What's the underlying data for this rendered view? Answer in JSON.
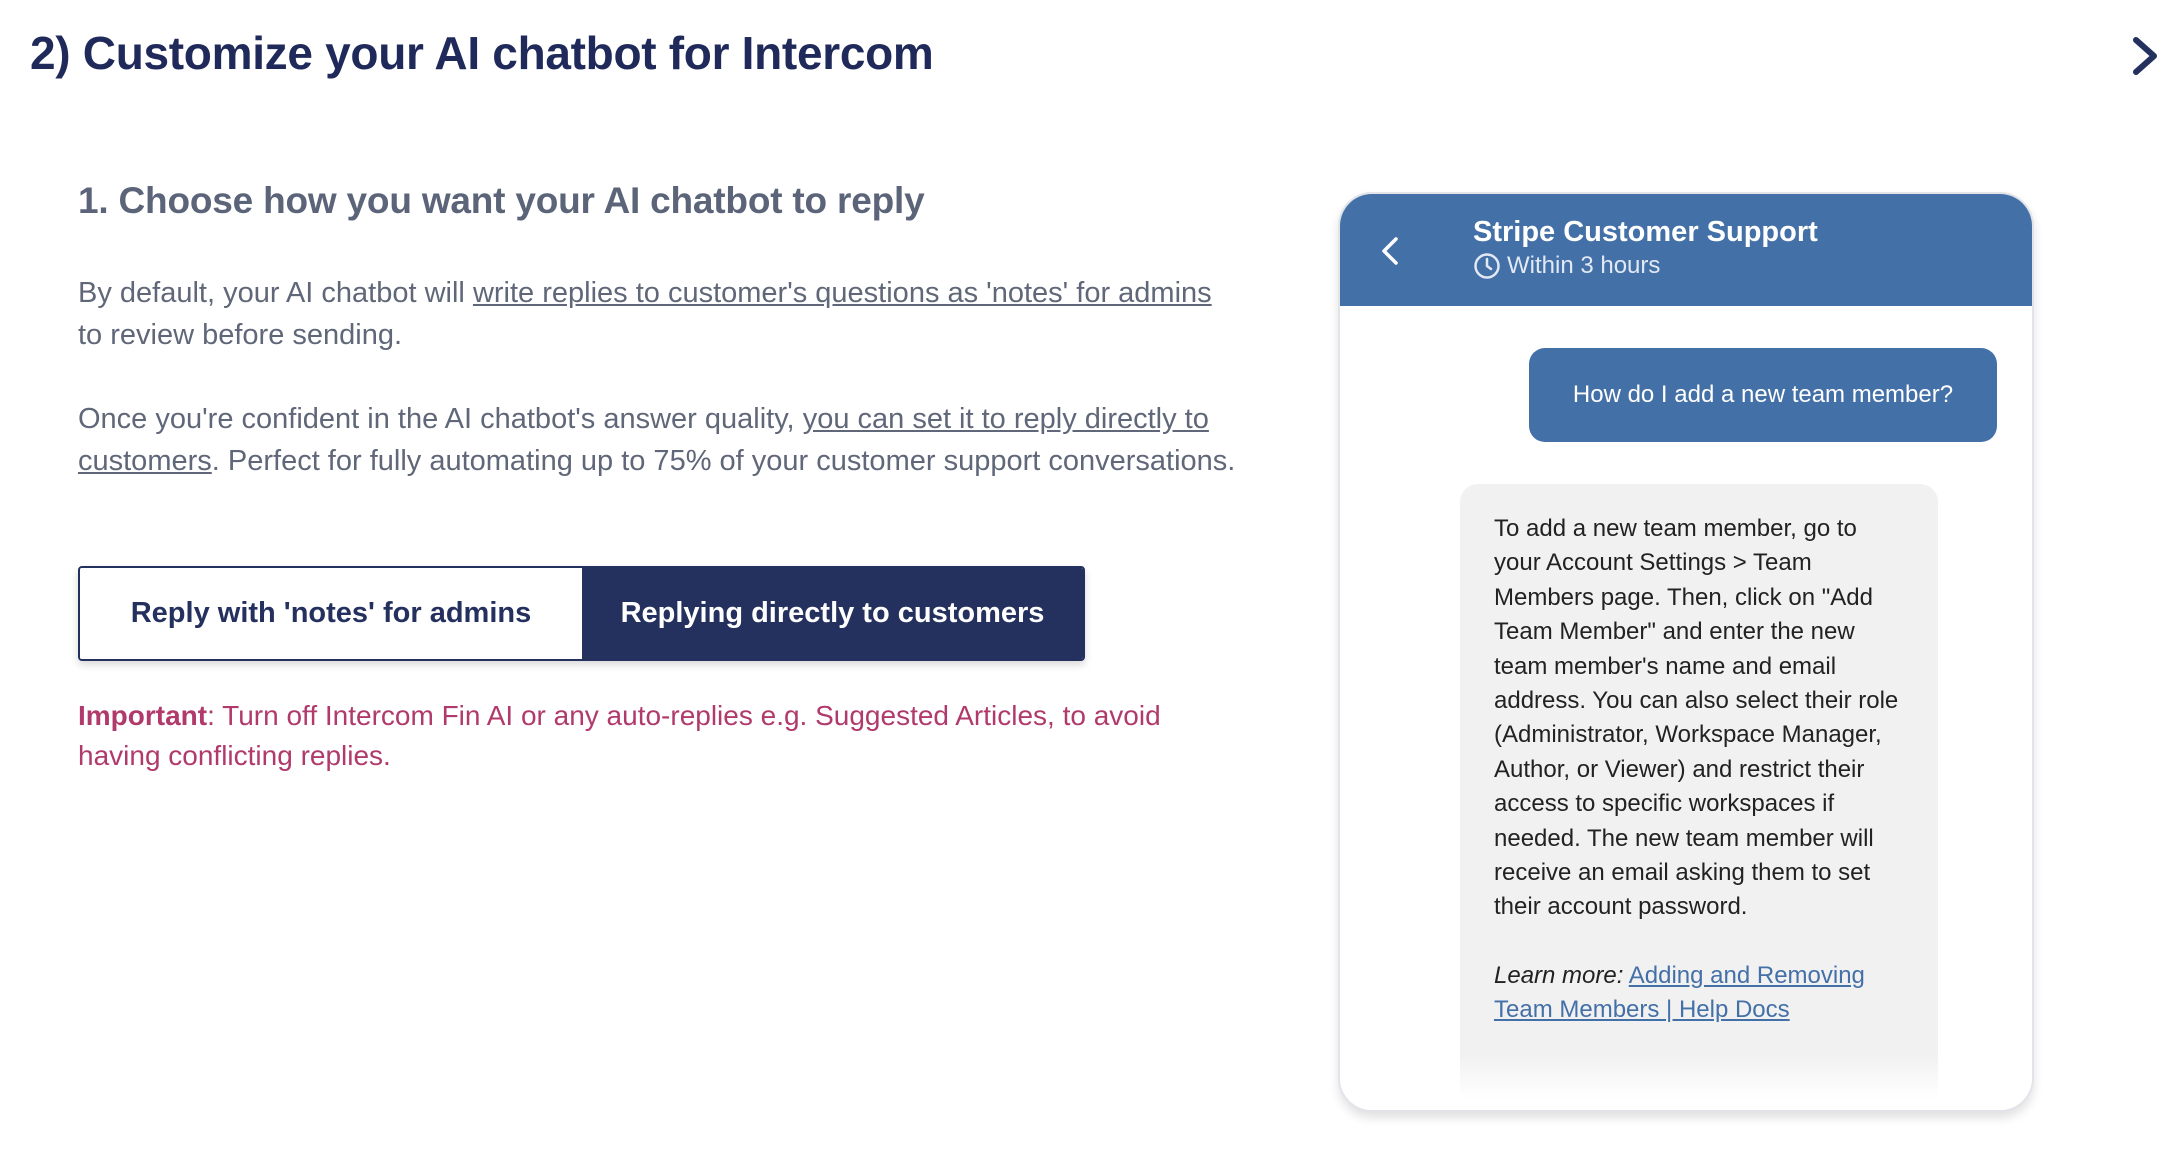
{
  "header": {
    "title": "2) Customize your AI chatbot for Intercom"
  },
  "section": {
    "title": "1. Choose how you want your AI chatbot to reply",
    "para1_start": "By default, your AI chatbot will ",
    "para1_link": "write replies to customer's questions as 'notes' for admins",
    "para1_end": " to review before sending.",
    "para2_start": "Once you're confident in the AI chatbot's answer quality, ",
    "para2_link": "you can set it to reply directly to customers",
    "para2_end": ". Perfect for fully automating up to 75% of your customer support conversations."
  },
  "toggle": {
    "notes_label": "Reply with 'notes' for admins",
    "direct_label": "Replying directly to customers",
    "selected": "direct"
  },
  "important": {
    "label": "Important",
    "text": ": Turn off Intercom Fin AI or any auto-replies e.g. Suggested Articles, to avoid having conflicting replies."
  },
  "chat": {
    "title": "Stripe Customer Support",
    "subtitle": "Within 3 hours",
    "user_message": "How do I add a new team member?",
    "bot_message": "To add a new team member, go to your Account Settings > Team Members page. Then, click on \"Add Team Member\" and enter the new team member's name and email address. You can also select their role (Administrator, Workspace Manager, Author, or Viewer) and restrict their access to specific workspaces if needed. The new team member will receive an email asking them to set their account password.",
    "learn_more_label": "Learn more:",
    "learn_more_link": "Adding and Removing Team Members | Help Docs"
  },
  "colors": {
    "navy": "#24305e",
    "chat_blue": "#4470a8",
    "important": "#b03a6b"
  },
  "icons": [
    "chevron-right-icon",
    "chevron-left-icon",
    "clock-icon"
  ]
}
